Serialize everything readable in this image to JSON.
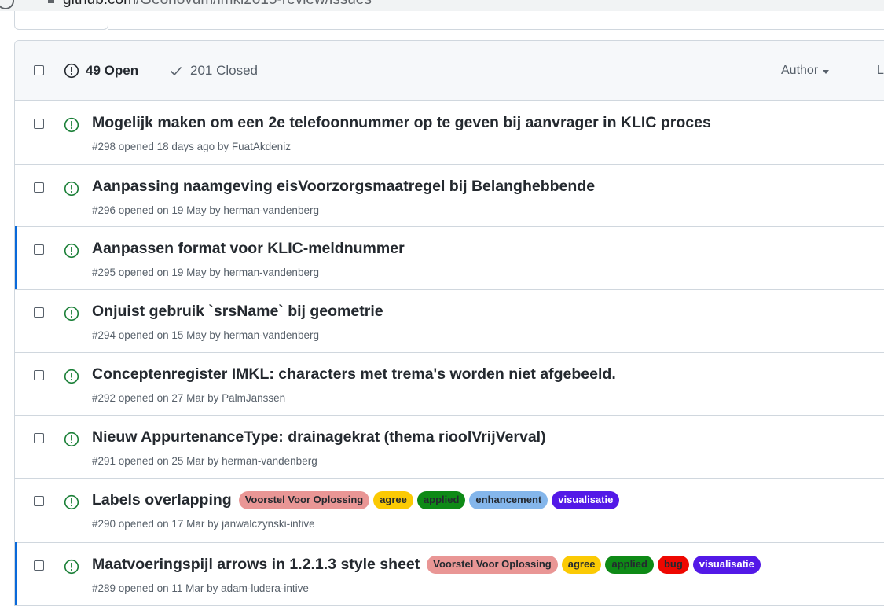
{
  "browser": {
    "url_host": "github.com",
    "url_path": "/Geonovum/imkl2015-review/issues"
  },
  "header": {
    "open_label": "49 Open",
    "closed_label": "201 Closed",
    "author_label": "Author",
    "next_filter_label": "L"
  },
  "issues": [
    {
      "title": "Mogelijk maken om een 2e telefoonnummer op te geven bij aanvrager in KLIC proces",
      "meta": "#298 opened 18 days ago by FuatAkdeniz",
      "labels": []
    },
    {
      "title": "Aanpassing naamgeving eisVoorzorgsmaatregel bij Belanghebbende",
      "meta": "#296 opened on 19 May by herman-vandenberg",
      "labels": []
    },
    {
      "title": "Aanpassen format voor KLIC-meldnummer",
      "meta": "#295 opened on 19 May by herman-vandenberg",
      "labels": []
    },
    {
      "title": "Onjuist gebruik `srsName` bij geometrie",
      "meta": "#294 opened on 15 May by herman-vandenberg",
      "labels": []
    },
    {
      "title": "Conceptenregister IMKL: characters met trema's worden niet afgebeeld.",
      "meta": "#292 opened on 27 Mar by PalmJanssen",
      "labels": []
    },
    {
      "title": "Nieuw AppurtenanceType: drainagekrat (thema rioolVrijVerval)",
      "meta": "#291 opened on 25 Mar by herman-vandenberg",
      "labels": []
    },
    {
      "title": "Labels overlapping",
      "meta": "#290 opened on 17 Mar by janwalczynski-intive",
      "labels": [
        {
          "text": "Voorstel Voor Oplossing",
          "bg": "#e99695",
          "fg": "#24292f"
        },
        {
          "text": "agree",
          "bg": "#fbca04",
          "fg": "#24292f"
        },
        {
          "text": "applied",
          "bg": "#0e8a16",
          "fg": "#24292f"
        },
        {
          "text": "enhancement",
          "bg": "#84b6eb",
          "fg": "#24292f"
        },
        {
          "text": "visualisatie",
          "bg": "#5319e7",
          "fg": "#ffffff"
        }
      ]
    },
    {
      "title": "Maatvoeringspijl arrows in 1.2.1.3 style sheet",
      "meta": "#289 opened on 11 Mar by adam-ludera-intive",
      "labels": [
        {
          "text": "Voorstel Voor Oplossing",
          "bg": "#e99695",
          "fg": "#24292f"
        },
        {
          "text": "agree",
          "bg": "#fbca04",
          "fg": "#24292f"
        },
        {
          "text": "applied",
          "bg": "#0e8a16",
          "fg": "#24292f"
        },
        {
          "text": "bug",
          "bg": "#ee0701",
          "fg": "#24292f"
        },
        {
          "text": "visualisatie",
          "bg": "#5319e7",
          "fg": "#ffffff"
        }
      ]
    }
  ],
  "colors": {
    "open_icon": "#1a7f37",
    "selected_border": "#0969da"
  }
}
